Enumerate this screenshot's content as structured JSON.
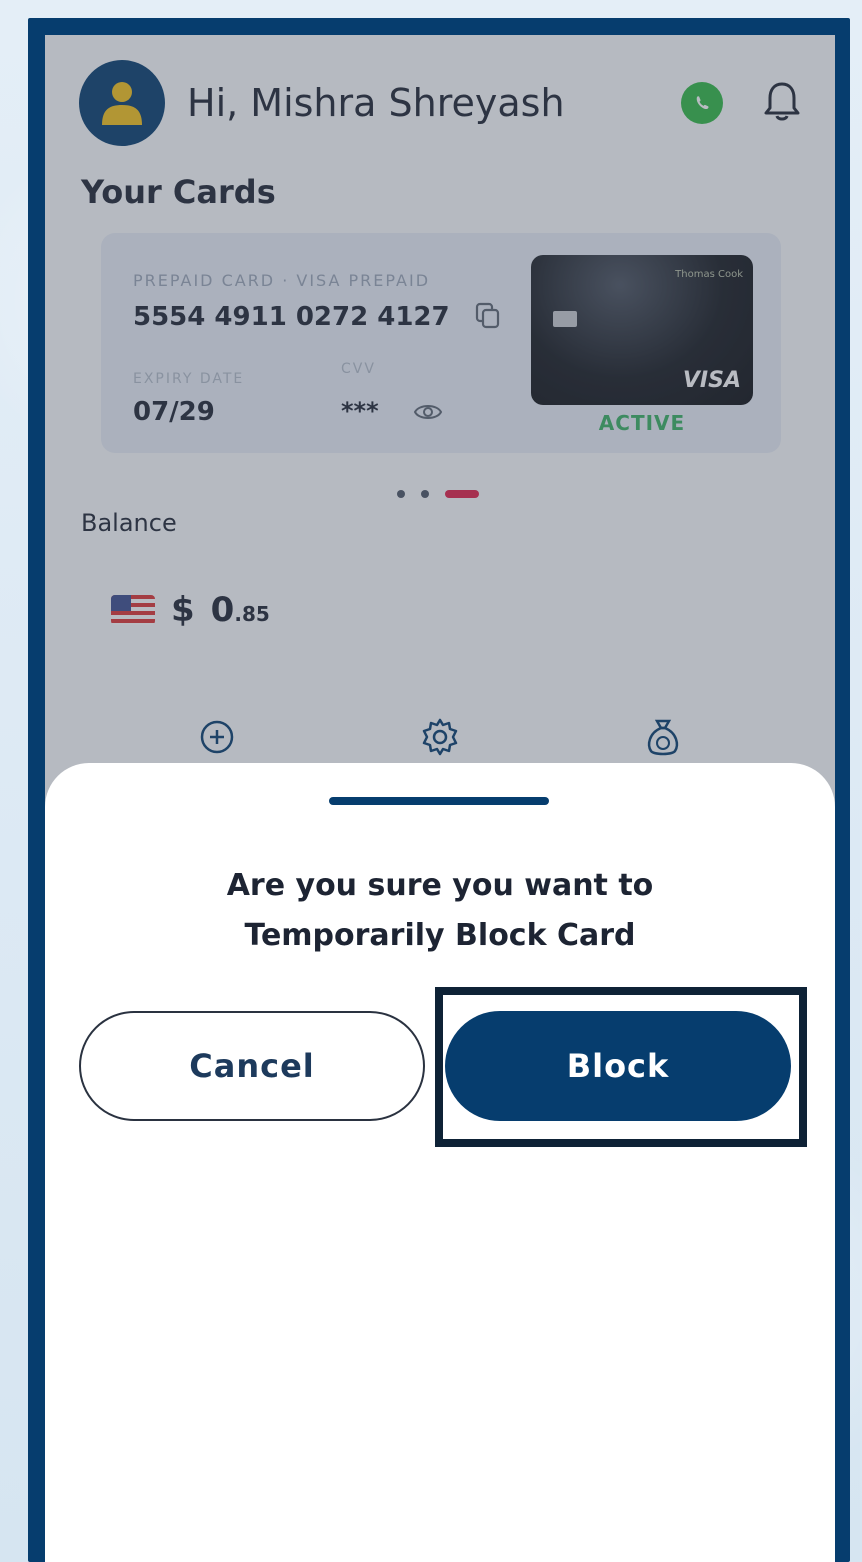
{
  "header": {
    "greeting": "Hi, Mishra Shreyash"
  },
  "cards_section": {
    "title": "Your Cards",
    "card": {
      "type_label": "PREPAID CARD · VISA PREPAID",
      "number": "5554 4911 0272 4127",
      "expiry_label": "EXPIRY DATE",
      "expiry": "07/29",
      "cvv_label": "CVV",
      "cvv": "***",
      "issuer_logo": "Thomas Cook",
      "network": "VISA",
      "status": "ACTIVE"
    },
    "carousel": {
      "count": 3,
      "active_index": 2
    }
  },
  "balance": {
    "label": "Balance",
    "currency_symbol": "$",
    "integer": "0",
    "decimal": ".85"
  },
  "sheet": {
    "message_line1": "Are you sure you want to",
    "message_line2": "Temporarily Block Card",
    "cancel_label": "Cancel",
    "block_label": "Block"
  },
  "colors": {
    "primary": "#063d6e",
    "status_active": "#38b062",
    "carousel_active": "#e11d48",
    "whatsapp": "#2fb845"
  },
  "icons": {
    "avatar": "user-icon",
    "whatsapp": "whatsapp-icon",
    "notifications": "bell-icon",
    "copy": "copy-icon",
    "reveal_cvv": "eye-icon",
    "action_1": "plus-circle-icon",
    "action_2": "gear-icon",
    "action_3": "money-bag-icon"
  }
}
